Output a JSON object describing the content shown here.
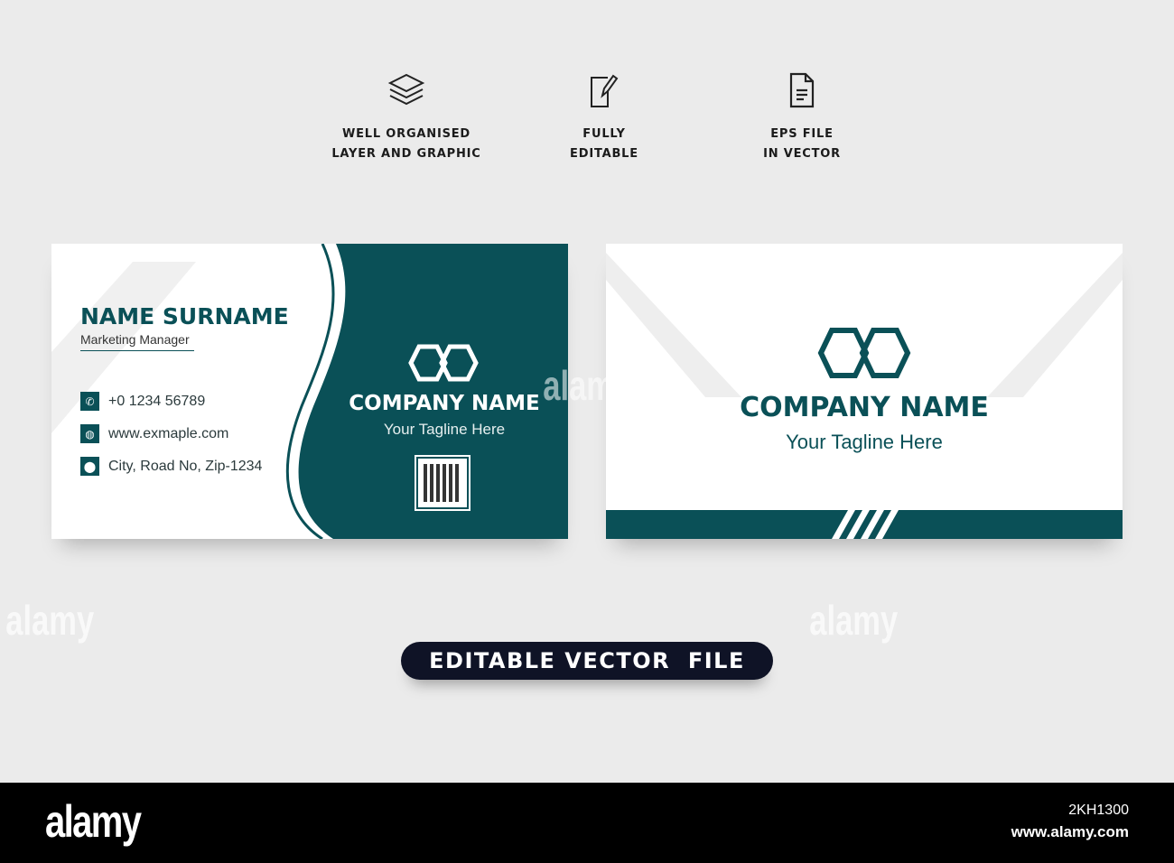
{
  "features": [
    {
      "icon": "layers-icon",
      "line1": "WELL ORGANISED",
      "line2": "LAYER AND GRAPHIC"
    },
    {
      "icon": "edit-icon",
      "line1": "FULLY",
      "line2": "EDITABLE"
    },
    {
      "icon": "document-icon",
      "line1": "EPS FILE",
      "line2": "IN VECTOR"
    }
  ],
  "front_card": {
    "name": "NAME SURNAME",
    "title": "Marketing Manager",
    "phone": "+0 1234 56789",
    "website": "www.exmaple.com",
    "address": "City, Road No, Zip-1234",
    "company": "COMPANY NAME",
    "tagline": "Your Tagline Here"
  },
  "back_card": {
    "company": "COMPANY NAME",
    "tagline": "Your Tagline Here"
  },
  "badge": "EDITABLE VECTOR  FILE",
  "footer": {
    "logo": "alamy",
    "image_id": "2KH1300",
    "url": "www.alamy.com"
  },
  "colors": {
    "teal": "#0a5057",
    "dark": "#0f1326",
    "background": "#ebebeb"
  }
}
